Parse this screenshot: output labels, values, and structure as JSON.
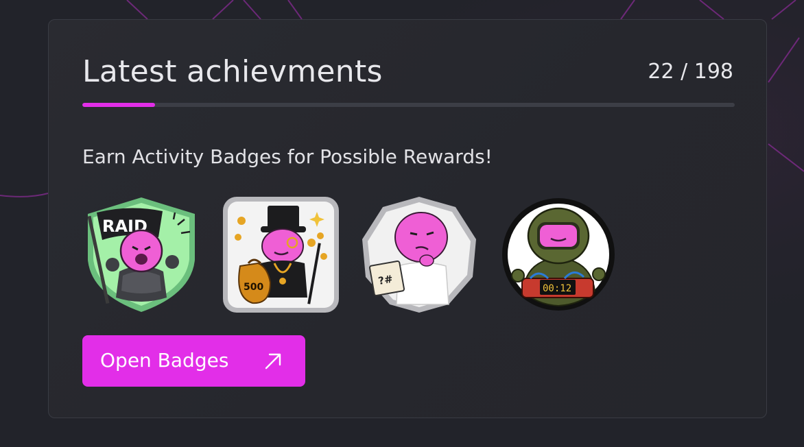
{
  "card": {
    "title": "Latest achievments",
    "count": "22 / 198",
    "progress": {
      "completed": 22,
      "total": 198
    },
    "subtitle": "Earn Activity Badges for Possible Rewards!",
    "button_label": "Open Badges",
    "button_icon": "arrow-up-right-icon"
  },
  "badges": [
    {
      "name": "raid-badge",
      "banner_text": "RAID"
    },
    {
      "name": "rich-badge",
      "bag_text": "500"
    },
    {
      "name": "thinker-badge",
      "paper_text": "?#"
    },
    {
      "name": "bomb-squad-badge",
      "timer_text": "00:12"
    }
  ],
  "colors": {
    "accent": "#e22ee8",
    "background": "#22232a",
    "card": "#27282e",
    "text": "#e8e8ec",
    "track": "#3c3e46"
  }
}
